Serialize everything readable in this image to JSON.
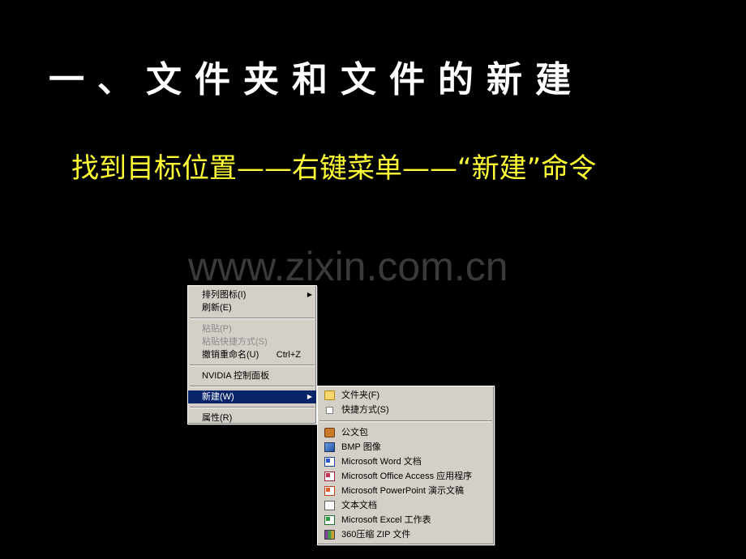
{
  "slide": {
    "title": "一、文件夹和文件的新建",
    "subtitle": "找到目标位置——右键菜单——“新建”命令",
    "watermark": "www.zixin.com.cn"
  },
  "context_menu": {
    "items": [
      {
        "label": "排列图标(I)",
        "has_submenu": true
      },
      {
        "label": "刷新(E)"
      },
      {
        "label": "粘贴(P)",
        "disabled": true
      },
      {
        "label": "粘贴快捷方式(S)",
        "disabled": true
      },
      {
        "label": "撤销重命名(U)",
        "shortcut": "Ctrl+Z"
      },
      {
        "label": "NVIDIA 控制面板"
      },
      {
        "label": "新建(W)",
        "has_submenu": true,
        "selected": true
      },
      {
        "label": "属性(R)"
      }
    ],
    "arrow_glyph": "▶"
  },
  "new_submenu": {
    "items": [
      {
        "label": "文件夹(F)",
        "icon": "folder-icon"
      },
      {
        "label": "快捷方式(S)",
        "icon": "shortcut-icon"
      },
      {
        "label": "公文包",
        "icon": "briefcase-icon"
      },
      {
        "label": "BMP 图像",
        "icon": "bmp-icon"
      },
      {
        "label": "Microsoft Word 文档",
        "icon": "word-doc-icon"
      },
      {
        "label": "Microsoft Office Access 应用程序",
        "icon": "access-icon"
      },
      {
        "label": "Microsoft PowerPoint 演示文稿",
        "icon": "powerpoint-icon"
      },
      {
        "label": "文本文档",
        "icon": "text-doc-icon"
      },
      {
        "label": "Microsoft Excel 工作表",
        "icon": "excel-icon"
      },
      {
        "label": "360压缩 ZIP 文件",
        "icon": "zip-icon"
      }
    ]
  },
  "colors": {
    "background": "#000000",
    "title": "#ffffff",
    "subtitle": "#ffff33",
    "menu_face": "#d4d0c8",
    "menu_highlight": "#0a246a"
  }
}
